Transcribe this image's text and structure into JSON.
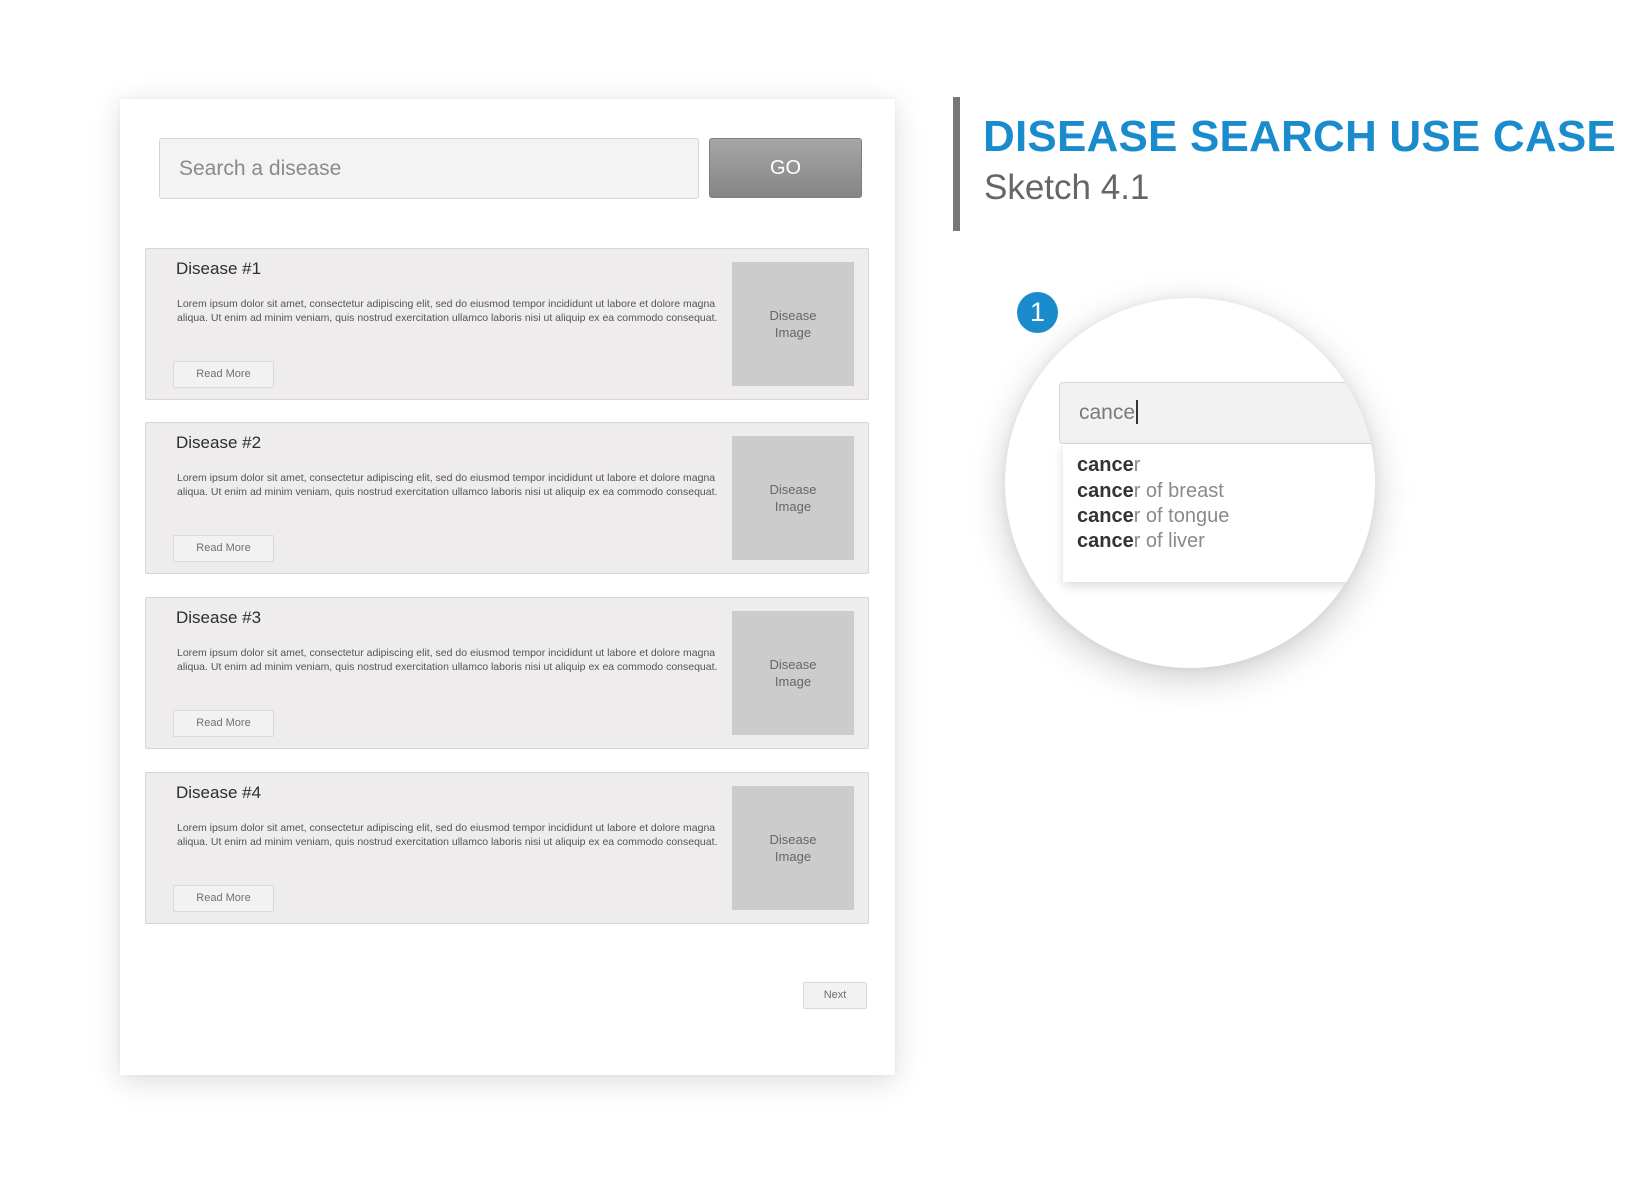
{
  "header": {
    "title": "DISEASE SEARCH USE CASE",
    "subtitle": "Sketch 4.1"
  },
  "search": {
    "placeholder": "Search a disease",
    "go_label": "GO"
  },
  "cards": [
    {
      "title": "Disease #1",
      "description": "Lorem ipsum dolor sit amet, consectetur adipiscing elit, sed do eiusmod tempor incididunt ut labore et dolore magna aliqua. Ut enim ad minim veniam, quis nostrud exercitation ullamco laboris nisi ut aliquip ex ea commodo consequat.",
      "read_more": "Read More",
      "image_label": "Disease Image"
    },
    {
      "title": "Disease #2",
      "description": "Lorem ipsum dolor sit amet, consectetur adipiscing elit, sed do eiusmod tempor incididunt ut labore et dolore magna aliqua. Ut enim ad minim veniam, quis nostrud exercitation ullamco laboris nisi ut aliquip ex ea commodo consequat.",
      "read_more": "Read More",
      "image_label": "Disease Image"
    },
    {
      "title": "Disease #3",
      "description": "Lorem ipsum dolor sit amet, consectetur adipiscing elit, sed do eiusmod tempor incididunt ut labore et dolore magna aliqua. Ut enim ad minim veniam, quis nostrud exercitation ullamco laboris nisi ut aliquip ex ea commodo consequat.",
      "read_more": "Read More",
      "image_label": "Disease Image"
    },
    {
      "title": "Disease #4",
      "description": "Lorem ipsum dolor sit amet, consectetur adipiscing elit, sed do eiusmod tempor incididunt ut labore et dolore magna aliqua. Ut enim ad minim veniam, quis nostrud exercitation ullamco laboris nisi ut aliquip ex ea commodo consequat.",
      "read_more": "Read More",
      "image_label": "Disease Image"
    }
  ],
  "pagination": {
    "next_label": "Next"
  },
  "zoom_detail": {
    "step_number": "1",
    "typed_value": "cance",
    "suggestions": [
      {
        "match": "cance",
        "rest": "r"
      },
      {
        "match": "cance",
        "rest": "r of breast"
      },
      {
        "match": "cance",
        "rest": "r of tongue"
      },
      {
        "match": "cance",
        "rest": "r of liver"
      }
    ]
  },
  "colors": {
    "accent": "#1a8ccd",
    "card_background": "#eeeced",
    "image_placeholder": "#cdcccd",
    "go_button": "#959595"
  }
}
